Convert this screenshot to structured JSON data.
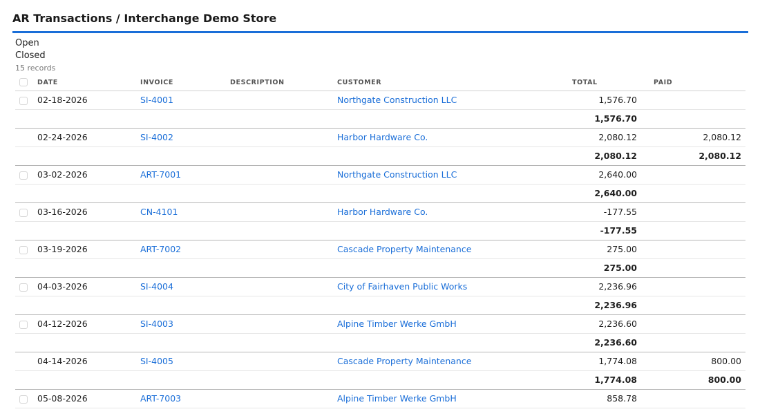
{
  "header": {
    "title": "AR Transactions / Interchange Demo Store"
  },
  "filters": {
    "open": "Open",
    "closed": "Closed",
    "record_count": "15 records"
  },
  "columns": {
    "date": "DATE",
    "invoice": "INVOICE",
    "description": "DESCRIPTION",
    "customer": "CUSTOMER",
    "total": "TOTAL",
    "paid": "PAID"
  },
  "colors": {
    "accent": "#1a6ed8"
  },
  "rows": [
    {
      "checkbox": true,
      "date": "02-18-2026",
      "invoice": "SI-4001",
      "description": "",
      "customer": "Northgate Construction LLC",
      "total": "1,576.70",
      "paid": "",
      "subtotal_total": "1,576.70",
      "subtotal_paid": ""
    },
    {
      "checkbox": false,
      "date": "02-24-2026",
      "invoice": "SI-4002",
      "description": "",
      "customer": "Harbor Hardware Co.",
      "total": "2,080.12",
      "paid": "2,080.12",
      "subtotal_total": "2,080.12",
      "subtotal_paid": "2,080.12"
    },
    {
      "checkbox": true,
      "date": "03-02-2026",
      "invoice": "ART-7001",
      "description": "",
      "customer": "Northgate Construction LLC",
      "total": "2,640.00",
      "paid": "",
      "subtotal_total": "2,640.00",
      "subtotal_paid": ""
    },
    {
      "checkbox": true,
      "date": "03-16-2026",
      "invoice": "CN-4101",
      "description": "",
      "customer": "Harbor Hardware Co.",
      "total": "-177.55",
      "paid": "",
      "subtotal_total": "-177.55",
      "subtotal_paid": ""
    },
    {
      "checkbox": true,
      "date": "03-19-2026",
      "invoice": "ART-7002",
      "description": "",
      "customer": "Cascade Property Maintenance",
      "total": "275.00",
      "paid": "",
      "subtotal_total": "275.00",
      "subtotal_paid": ""
    },
    {
      "checkbox": true,
      "date": "04-03-2026",
      "invoice": "SI-4004",
      "description": "",
      "customer": "City of Fairhaven Public Works",
      "total": "2,236.96",
      "paid": "",
      "subtotal_total": "2,236.96",
      "subtotal_paid": ""
    },
    {
      "checkbox": true,
      "date": "04-12-2026",
      "invoice": "SI-4003",
      "description": "",
      "customer": "Alpine Timber Werke GmbH",
      "total": "2,236.60",
      "paid": "",
      "subtotal_total": "2,236.60",
      "subtotal_paid": ""
    },
    {
      "checkbox": false,
      "date": "04-14-2026",
      "invoice": "SI-4005",
      "description": "",
      "customer": "Cascade Property Maintenance",
      "total": "1,774.08",
      "paid": "800.00",
      "subtotal_total": "1,774.08",
      "subtotal_paid": "800.00"
    },
    {
      "checkbox": true,
      "date": "05-08-2026",
      "invoice": "ART-7003",
      "description": "",
      "customer": "Alpine Timber Werke GmbH",
      "total": "858.78",
      "paid": ""
    }
  ]
}
